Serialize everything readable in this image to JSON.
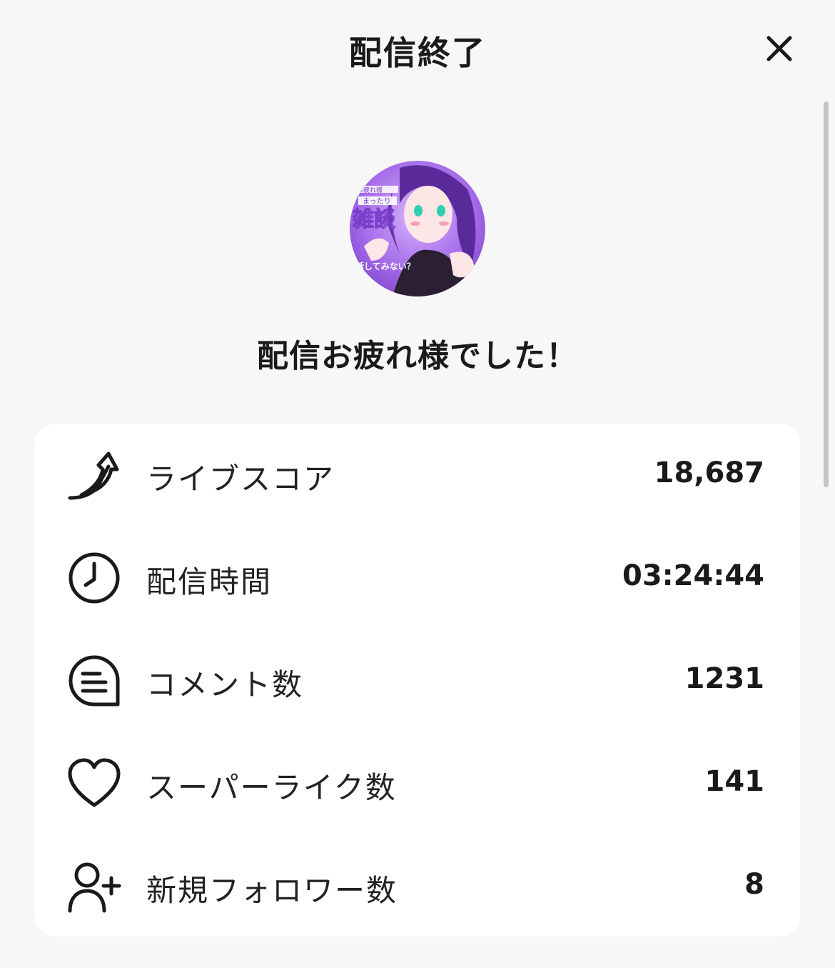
{
  "header": {
    "title": "配信終了"
  },
  "avatar": {
    "text_top": "お疲れ様",
    "text_mid": "まったり",
    "text_big": "雑談",
    "text_bottom": "話してみない？",
    "bg_color": "#9b59e0"
  },
  "message": "配信お疲れ様でした！",
  "stats": [
    {
      "icon": "live-score-arrow-icon",
      "label": "ライブスコア",
      "value": "18,687"
    },
    {
      "icon": "clock-icon",
      "label": "配信時間",
      "value": "03:24:44"
    },
    {
      "icon": "comment-icon",
      "label": "コメント数",
      "value": "1231"
    },
    {
      "icon": "heart-icon",
      "label": "スーパーライク数",
      "value": "141"
    },
    {
      "icon": "add-user-icon",
      "label": "新規フォロワー数",
      "value": "8"
    }
  ],
  "colors": {
    "background": "#f7f7f7",
    "card": "#ffffff",
    "text": "#1a1a1a"
  }
}
